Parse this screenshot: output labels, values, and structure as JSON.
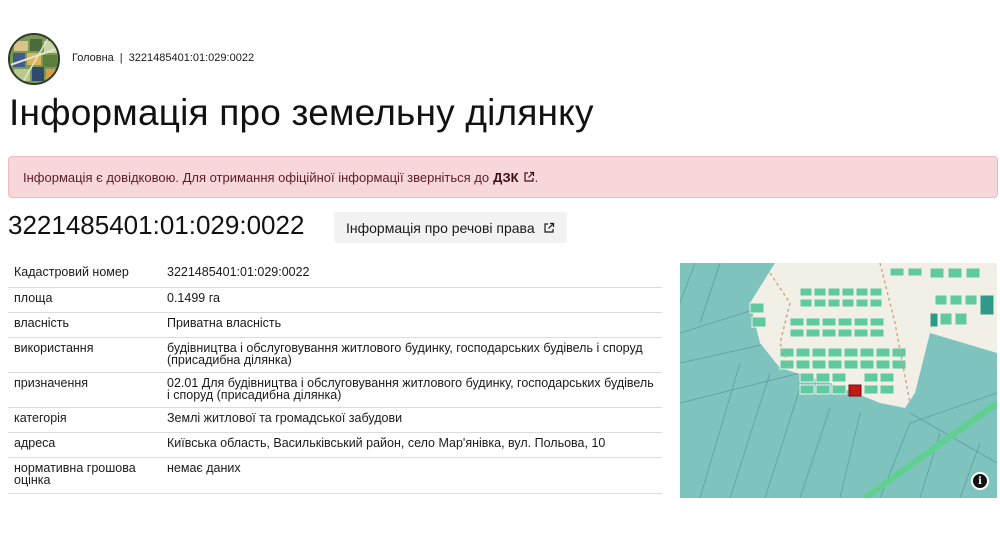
{
  "breadcrumb": {
    "home": "Головна",
    "separator": "|",
    "current": "3221485401:01:029:0022"
  },
  "page_title": "Інформація про земельну ділянку",
  "notice": {
    "text": "Інформація є довідковою. Для отримання офіційної інформації зверніться до",
    "link": "ДЗК",
    "suffix": "."
  },
  "cadastral_title": "3221485401:01:029:0022",
  "rights_button": "Інформація про речові права",
  "table": [
    {
      "key": "Кадастровий номер",
      "value": "3221485401:01:029:0022"
    },
    {
      "key": "площа",
      "value": "0.1499 га"
    },
    {
      "key": "власність",
      "value": "Приватна власність"
    },
    {
      "key": "використання",
      "value": "будівництва і обслуговування житлового будинку, господарських будівель і споруд (присадибна ділянка)"
    },
    {
      "key": "призначення",
      "value": "02.01 Для будівництва і обслуговування житлового будинку, господарських будівель і споруд (присадибна ділянка)"
    },
    {
      "key": "категорія",
      "value": "Землі житлової та громадської забудови"
    },
    {
      "key": "адреса",
      "value": "Київська область, Васильківський район, село Мар'янівка, вул. Польова, 10"
    },
    {
      "key": "нормативна грошова оцінка",
      "value": "немає даних"
    }
  ],
  "map": {
    "info_icon": "info-icon",
    "colors": {
      "parcel": "#7ec3bd",
      "residential": "#5fc9a0",
      "selected": "#c21818",
      "background": "#f2f0e6"
    }
  },
  "icons": {
    "external": "external-link-icon"
  }
}
